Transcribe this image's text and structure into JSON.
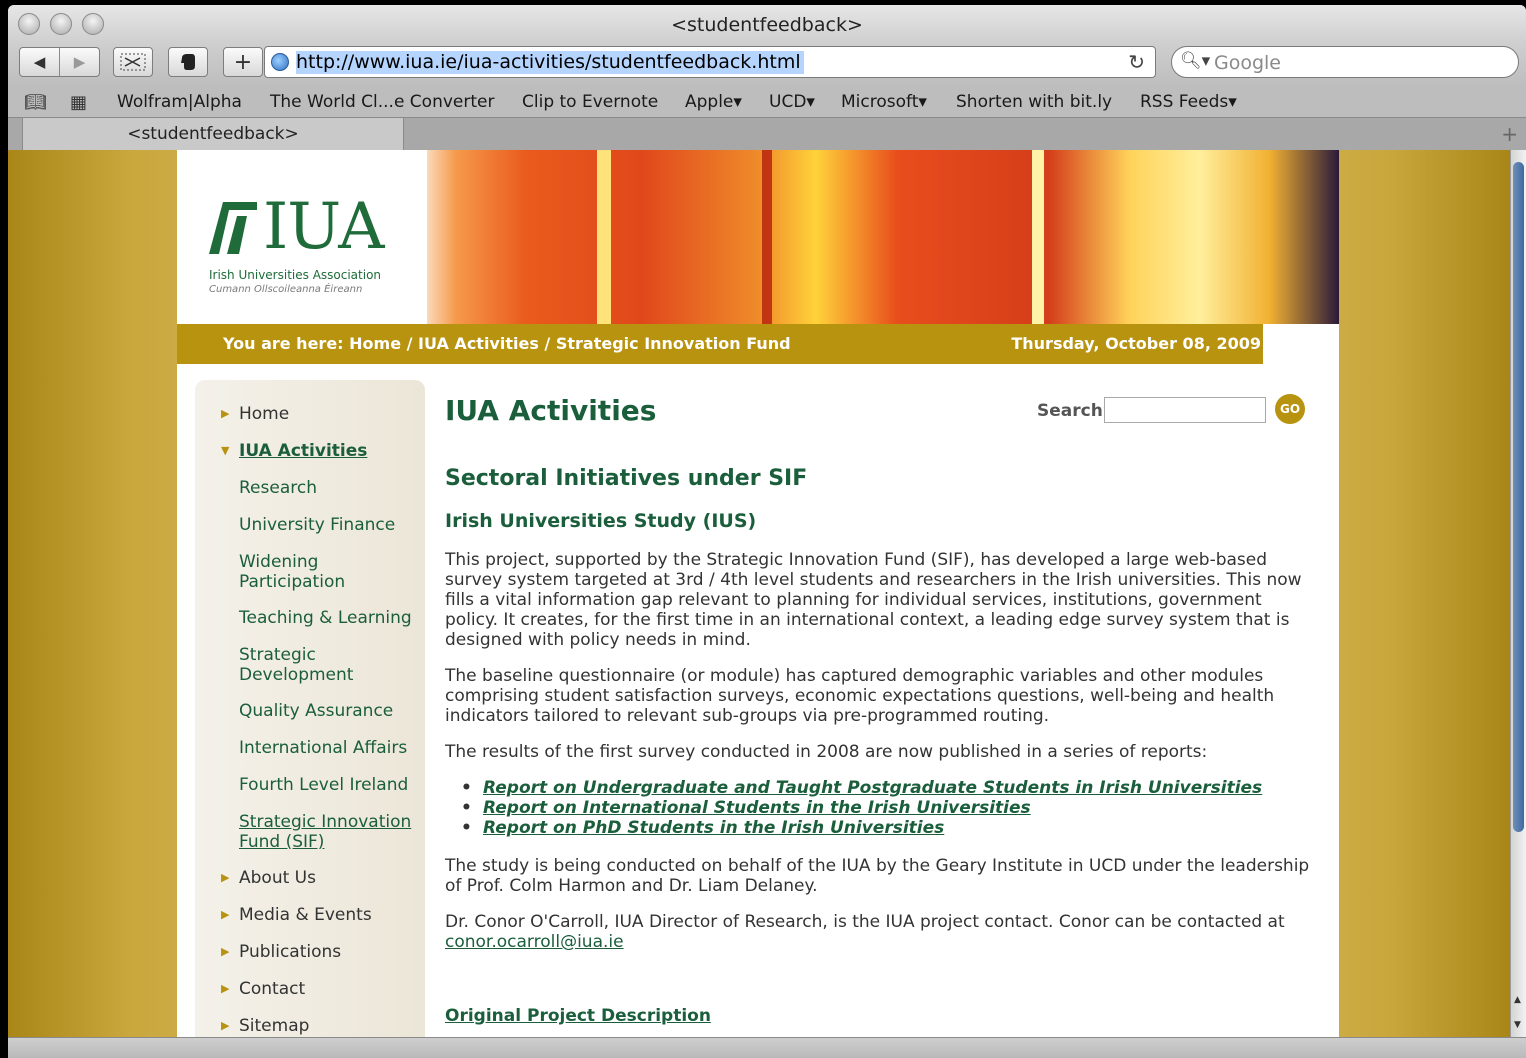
{
  "window": {
    "title": "<studentfeedback>"
  },
  "toolbar": {
    "url": "http://www.iua.ie/iua-activities/studentfeedback.html",
    "search_placeholder": "Google"
  },
  "bookmarks": [
    "Wolfram|Alpha",
    "The World Cl...e Converter",
    "Clip to Evernote",
    "Apple▾",
    "UCD▾",
    "Microsoft▾",
    "Shorten with bit.ly",
    "RSS Feeds▾"
  ],
  "tab": {
    "label": "<studentfeedback>"
  },
  "logo": {
    "text": "IUA",
    "subtitle": "Irish Universities Association",
    "subtitle_irish": "Cumann Ollscoileanna Éireann"
  },
  "breadcrumb": {
    "text": "You are here: Home / IUA Activities / Strategic Innovation Fund",
    "date": "Thursday, October 08, 2009"
  },
  "sidebar": {
    "items": [
      {
        "label": "Home",
        "type": "top"
      },
      {
        "label": "IUA Activities",
        "type": "active"
      },
      {
        "label": "Research",
        "type": "sub"
      },
      {
        "label": "University Finance",
        "type": "sub"
      },
      {
        "label": "Widening Participation",
        "type": "sub"
      },
      {
        "label": "Teaching & Learning",
        "type": "sub"
      },
      {
        "label": "Strategic Development",
        "type": "sub"
      },
      {
        "label": "Quality Assurance",
        "type": "sub"
      },
      {
        "label": "International Affairs",
        "type": "sub"
      },
      {
        "label": "Fourth Level Ireland",
        "type": "sub"
      },
      {
        "label": "Strategic Innovation Fund (SIF)",
        "type": "current"
      },
      {
        "label": "About Us",
        "type": "top"
      },
      {
        "label": "Media & Events",
        "type": "top"
      },
      {
        "label": "Publications",
        "type": "top"
      },
      {
        "label": "Contact",
        "type": "top"
      },
      {
        "label": "Sitemap",
        "type": "top"
      }
    ]
  },
  "main": {
    "title": "IUA Activities",
    "search_label": "Search",
    "search_button": "GO",
    "section_title": "Sectoral Initiatives under SIF",
    "subsection_title": "Irish Universities Study (IUS)",
    "para1": "This project, supported by the Strategic Innovation Fund (SIF), has developed a large web-based survey system targeted at 3rd / 4th level students and researchers in the Irish universities. This now fills a vital information gap relevant to planning for individual services, institutions, government policy. It creates, for the first time in an international context, a leading edge survey system that is designed with policy needs in mind.",
    "para2": "The baseline questionnaire (or module) has captured demographic variables and other modules comprising student satisfaction surveys, economic expectations questions, well-being and health indicators tailored to relevant sub-groups via pre-programmed routing.",
    "para3": "The results of the first survey conducted in 2008 are now published in a series of reports:",
    "reports": [
      "Report on Undergraduate and Taught Postgraduate Students in Irish Universities",
      "Report on International Students in the Irish Universities",
      "Report on PhD Students in the Irish Universities"
    ],
    "para4": "The study is being conducted on behalf of the IUA by the Geary Institute in UCD under the leadership of Prof. Colm Harmon and Dr. Liam Delaney.",
    "para5_prefix": "Dr. Conor O'Carroll, IUA Director of Research, is the IUA project contact. Conor can be contacted at ",
    "email": "conor.ocarroll@iua.ie",
    "original_link": "Original Project Description"
  }
}
